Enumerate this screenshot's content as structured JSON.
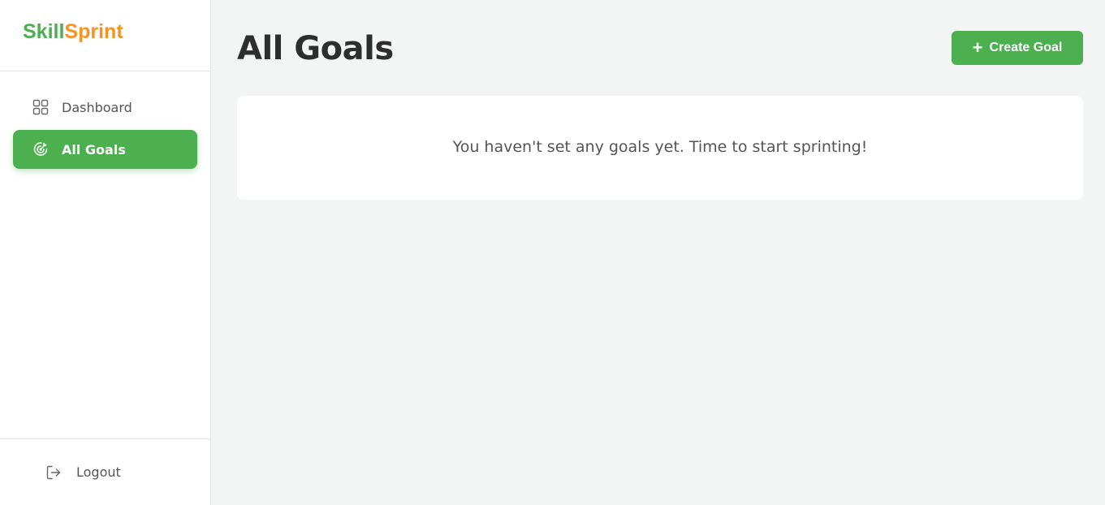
{
  "brand": {
    "part1": "Skill",
    "part2": "Sprint",
    "color1": "#4caf50",
    "color2": "#f7931e"
  },
  "sidebar": {
    "items": [
      {
        "label": "Dashboard",
        "icon": "grid-icon",
        "active": false
      },
      {
        "label": "All Goals",
        "icon": "target-icon",
        "active": true
      }
    ],
    "logout": {
      "label": "Logout",
      "icon": "logout-icon"
    }
  },
  "main": {
    "title": "All Goals",
    "create_button": {
      "label": "Create Goal",
      "icon": "plus-icon"
    },
    "empty_message": "You haven't set any goals yet. Time to start sprinting!"
  },
  "colors": {
    "accent": "#4caf50",
    "background": "#f3f5f4",
    "card": "#ffffff"
  }
}
